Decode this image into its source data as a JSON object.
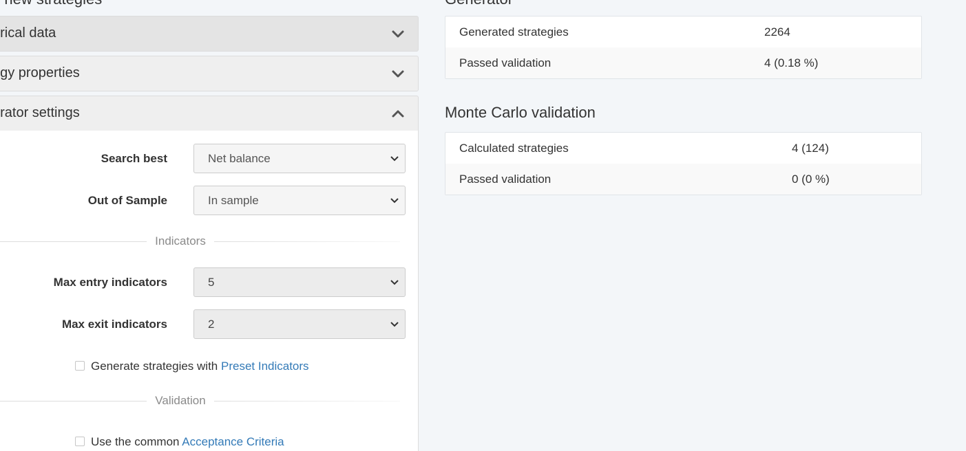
{
  "page": {
    "left_title": "e new strategies",
    "right_title_top": "Generator"
  },
  "accordion": {
    "historical_label": "orical data",
    "strategy_label": "egy properties",
    "generator_label": "erator settings"
  },
  "generator_form": {
    "search_best_label": "Search best",
    "search_best_value": "Net balance",
    "oos_label": "Out of Sample",
    "oos_value": "In sample",
    "indicators_divider": "Indicators",
    "max_entry_label": "Max entry indicators",
    "max_entry_value": "5",
    "max_exit_label": "Max exit indicators",
    "max_exit_value": "2",
    "preset_text": "Generate strategies with ",
    "preset_link": "Preset Indicators",
    "validation_divider": "Validation",
    "acceptance_text": "Use the common ",
    "acceptance_link": "Acceptance Criteria"
  },
  "generator_panel": {
    "rows": [
      {
        "key": "Generated strategies",
        "value": "2264"
      },
      {
        "key": "Passed validation",
        "value": "4 (0.18 %)"
      }
    ]
  },
  "monte_carlo": {
    "title": "Monte Carlo validation",
    "rows": [
      {
        "key": "Calculated strategies",
        "value": "4 (124)"
      },
      {
        "key": "Passed validation",
        "value": "0 (0 %)"
      }
    ]
  },
  "icons": {
    "chevron": "chevron-icon",
    "caret": "caret-down-icon"
  },
  "colors": {
    "link": "#337ab7",
    "background": "#f3f6f9"
  }
}
